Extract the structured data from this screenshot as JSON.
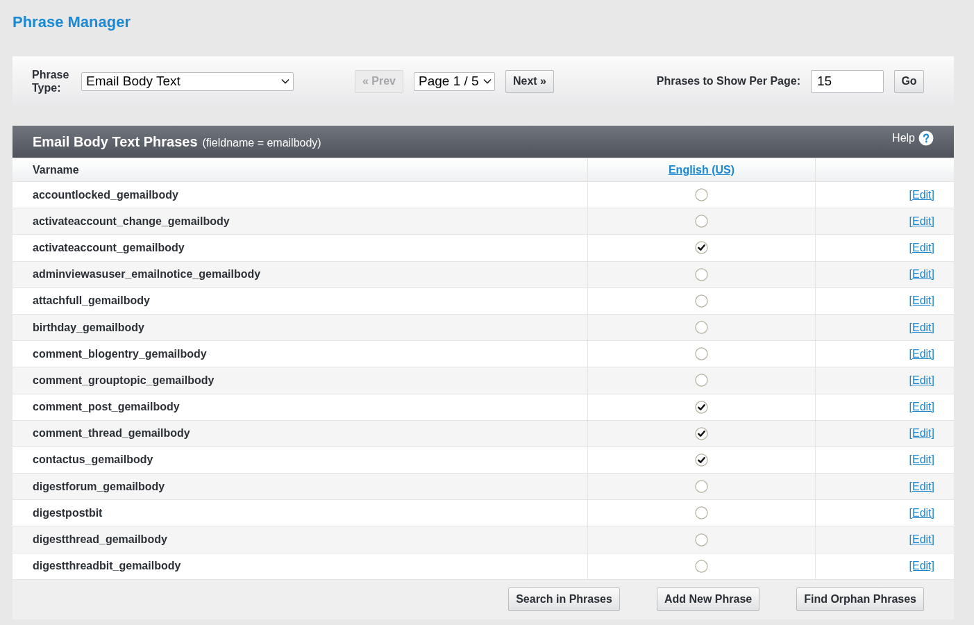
{
  "title": "Phrase Manager",
  "toolbar": {
    "phrase_type_label": "Phrase Type:",
    "phrase_type": {
      "value": "Email Body Text"
    },
    "prev_button": {
      "label": "« Prev",
      "disabled": true
    },
    "page_select": {
      "value": "Page 1 / 5"
    },
    "next_button": {
      "label": "Next »",
      "disabled": false
    },
    "per_page_label": "Phrases to Show Per Page:",
    "per_page": {
      "value": "15"
    },
    "go_button": {
      "label": "Go"
    }
  },
  "table": {
    "title": "Email Body Text Phrases",
    "subtitle": "(fieldname = emailbody)",
    "help": "Help",
    "columns": [
      "Varname",
      "English (US)"
    ],
    "rows": [
      {
        "varname": "accountlocked_gemailbody",
        "checked": false,
        "action": "[Edit]"
      },
      {
        "varname": "activateaccount_change_gemailbody",
        "checked": false,
        "action": "[Edit]"
      },
      {
        "varname": "activateaccount_gemailbody",
        "checked": true,
        "action": "[Edit]"
      },
      {
        "varname": "adminviewasuser_emailnotice_gemailbody",
        "checked": false,
        "action": "[Edit]"
      },
      {
        "varname": "attachfull_gemailbody",
        "checked": false,
        "action": "[Edit]"
      },
      {
        "varname": "birthday_gemailbody",
        "checked": false,
        "action": "[Edit]"
      },
      {
        "varname": "comment_blogentry_gemailbody",
        "checked": false,
        "action": "[Edit]"
      },
      {
        "varname": "comment_grouptopic_gemailbody",
        "checked": false,
        "action": "[Edit]"
      },
      {
        "varname": "comment_post_gemailbody",
        "checked": true,
        "action": "[Edit]"
      },
      {
        "varname": "comment_thread_gemailbody",
        "checked": true,
        "action": "[Edit]"
      },
      {
        "varname": "contactus_gemailbody",
        "checked": true,
        "action": "[Edit]"
      },
      {
        "varname": "digestforum_gemailbody",
        "checked": false,
        "action": "[Edit]"
      },
      {
        "varname": "digestpostbit",
        "checked": false,
        "action": "[Edit]"
      },
      {
        "varname": "digestthread_gemailbody",
        "checked": false,
        "action": "[Edit]"
      },
      {
        "varname": "digestthreadbit_gemailbody",
        "checked": false,
        "action": "[Edit]"
      }
    ]
  },
  "footer_buttons": [
    "Search in Phrases",
    "Add New Phrase",
    "Find Orphan Phrases"
  ]
}
